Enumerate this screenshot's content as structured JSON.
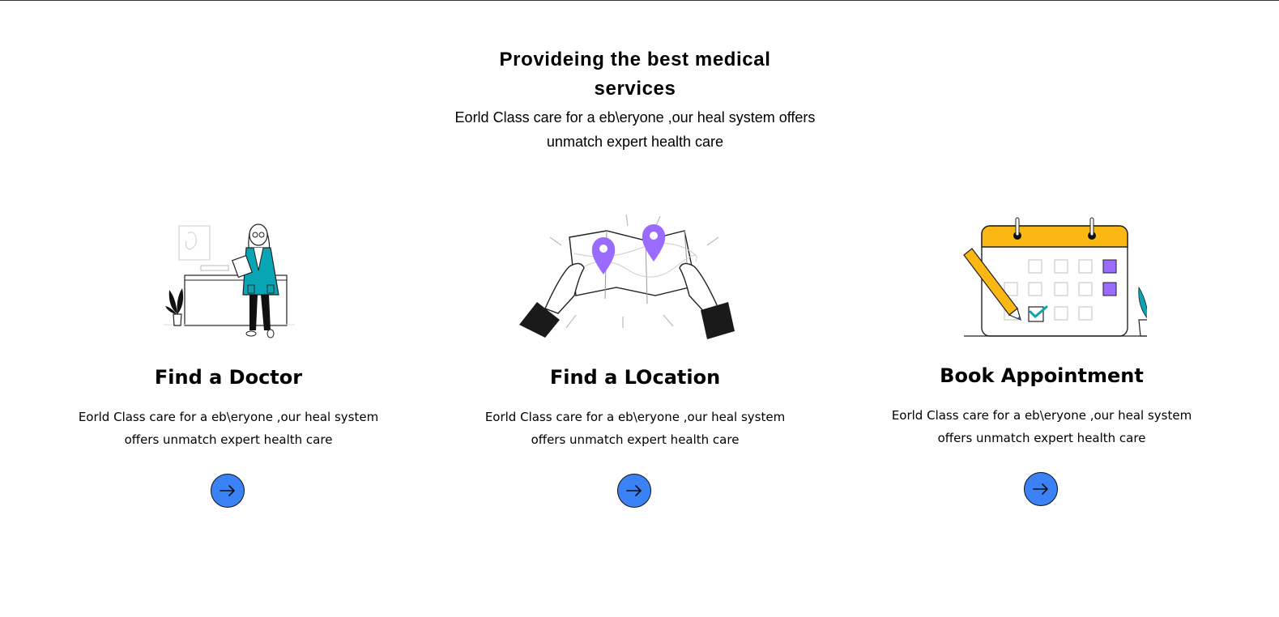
{
  "hero": {
    "title": "Provideing the best medical services",
    "subtitle": "Eorld Class care for a eb\\eryone ,our heal system offers unmatch expert health care"
  },
  "cards": [
    {
      "title": "Find a Doctor",
      "text": "Eorld Class care for a eb\\eryone ,our heal system offers unmatch expert health care",
      "icon": "doctor-illustration",
      "button_icon": "arrow-right-icon"
    },
    {
      "title": "Find a LOcation",
      "text": "Eorld Class care for a eb\\eryone ,our heal system offers unmatch expert health care",
      "icon": "map-illustration",
      "button_icon": "arrow-right-icon"
    },
    {
      "title": "Book Appointment",
      "text": "Eorld Class care for a eb\\eryone ,our heal system offers unmatch expert health care",
      "icon": "calendar-illustration",
      "button_icon": "arrow-right-icon"
    }
  ],
  "colors": {
    "button": "#3b82f6",
    "teal": "#0aa5b5",
    "purple": "#9b6bff",
    "yellow": "#fbb713"
  }
}
